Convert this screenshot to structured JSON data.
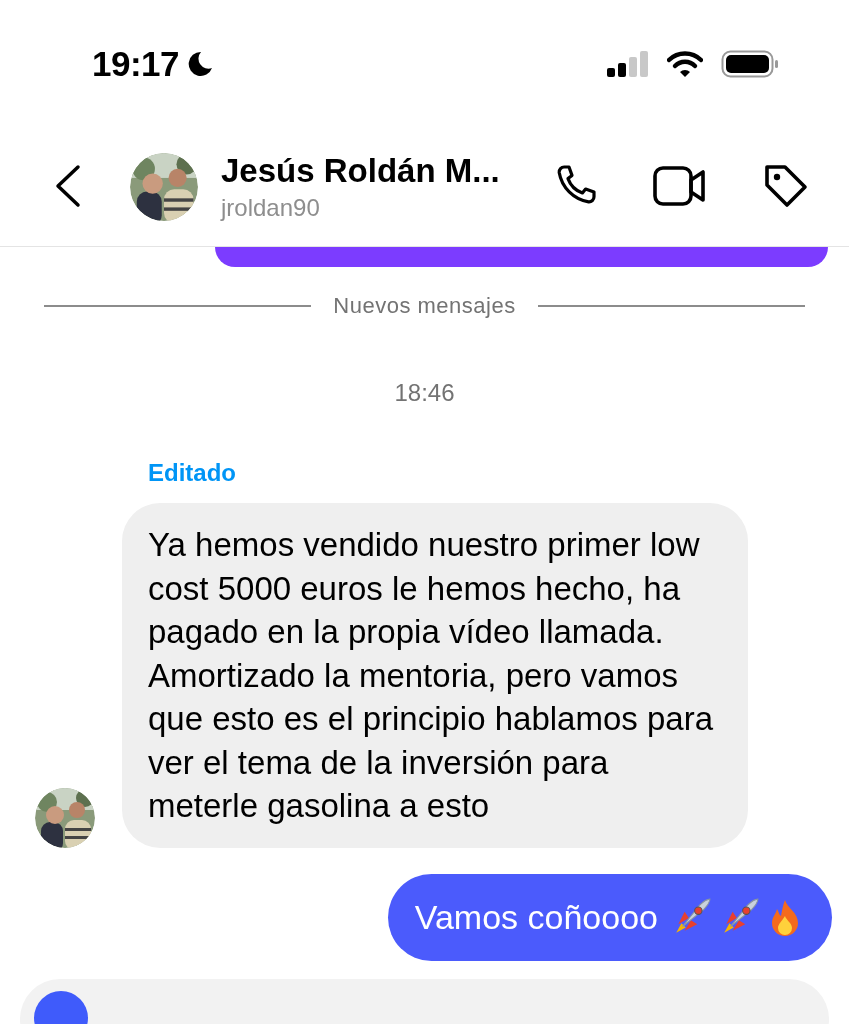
{
  "status_bar": {
    "time": "19:17",
    "focus_mode": true
  },
  "header": {
    "name": "Jesús Roldán M...",
    "username": "jroldan90"
  },
  "divider": {
    "label": "Nuevos mensajes"
  },
  "messages": [
    {
      "kind": "sent_cut"
    },
    {
      "kind": "separator"
    },
    {
      "kind": "timestamp",
      "text": "18:46"
    },
    {
      "kind": "received",
      "edited_label": "Editado",
      "text": "Ya hemos vendido nuestro primer low cost 5000 euros le hemos hecho, ha pagado en la propia vídeo llamada. Amortizado la mentoria, pero vamos que esto es el principio hablamos para ver el tema de la inversión para meterle gasolina a esto"
    },
    {
      "kind": "sent",
      "text": "Vamos coñoooo",
      "emoji": [
        {
          "kind": "rocket"
        },
        {
          "kind": "rocket"
        },
        {
          "kind": "fire"
        }
      ]
    }
  ]
}
